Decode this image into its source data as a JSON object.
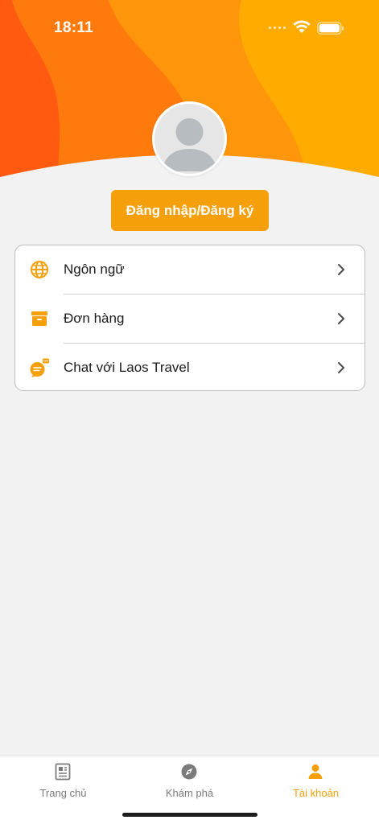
{
  "status_bar": {
    "time": "18:11"
  },
  "profile": {
    "login_label": "Đăng nhập/Đăng ký"
  },
  "menu": {
    "items": [
      {
        "label": "Ngôn ngữ",
        "icon": "globe-icon"
      },
      {
        "label": "Đơn hàng",
        "icon": "archive-box-icon"
      },
      {
        "label": "Chat với Laos Travel",
        "icon": "chat-bubble-icon"
      }
    ]
  },
  "tab_bar": {
    "tabs": [
      {
        "label": "Trang chủ",
        "icon": "newspaper-icon",
        "active": false
      },
      {
        "label": "Khám phá",
        "icon": "compass-icon",
        "active": false
      },
      {
        "label": "Tài khoản",
        "icon": "person-icon",
        "active": true
      }
    ]
  },
  "colors": {
    "accent": "#f5a00a",
    "header_orange_dark": "#ff5a10",
    "header_orange_mid": "#ff8a0a",
    "header_orange_light": "#ffab00",
    "background": "#f2f2f2",
    "tab_inactive": "#7a7a7a"
  }
}
